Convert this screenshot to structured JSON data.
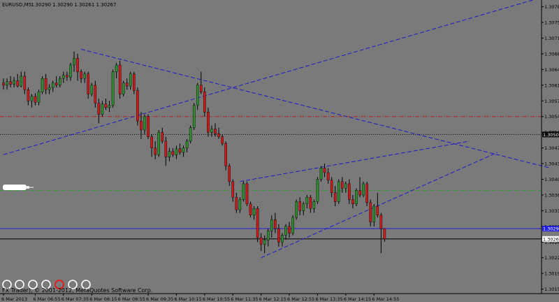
{
  "header": {
    "symbol_label": "EURUSD,M5",
    "ohlc_label": "1.30290 1.30290 1.30261 1.30267"
  },
  "footer": {
    "copyright_label": "FX Trader), © 2001-2012, MetaQuotes Software Corp."
  },
  "colors": {
    "background": "#7a7a7a",
    "bull_candle": "#2e8b2e",
    "bear_candle": "#cc1a1a",
    "wick": "#000000",
    "trendline": "#1c1cc8",
    "level_red": "#b22222",
    "level_black": "#000000",
    "level_green": "#2f9a2f",
    "level_blue": "#1f1fe0",
    "level_black_bottom": "#000000"
  },
  "chart_data": {
    "type": "candlestick",
    "timeframe": "M5",
    "y_axis_ticks": [
      1.30785,
      1.3075,
      1.30715,
      1.3068,
      1.30645,
      1.3061,
      1.30575,
      1.3054,
      1.30505,
      1.3047,
      1.30435,
      1.304,
      1.30365,
      1.3033,
      1.30295,
      1.3026,
      1.30225,
      1.3019,
      1.30155
    ],
    "ylim": [
      1.30145,
      1.308
    ],
    "x_tick_labels": [
      "6 Mar 2013",
      "6 Mar 06:55",
      "6 Mar 07:35",
      "6 Mar 08:15",
      "6 Mar 08:55",
      "6 Mar 09:35",
      "6 Mar 10:15",
      "6 Mar 10:55",
      "6 Mar 11:35",
      "6 Mar 12:15",
      "6 Mar 12:55",
      "6 Mar 13:35",
      "6 Mar 14:15",
      "6 Mar 14:55"
    ],
    "x_tick_bar_index": [
      0,
      9,
      17,
      25,
      33,
      41,
      49,
      57,
      65,
      73,
      81,
      89,
      97,
      105
    ],
    "horizontal_levels": [
      {
        "price": 1.3054,
        "style": "dash-dot",
        "color": "#b22222",
        "label": ""
      },
      {
        "price": 1.305,
        "style": "dotted",
        "color": "#000000",
        "label": "1.30500"
      },
      {
        "price": 1.30375,
        "style": "dash-dot",
        "color": "#2f9a2f",
        "label": ""
      },
      {
        "price": 1.3029,
        "style": "solid",
        "color": "#1f1fe0",
        "label": "1.30290"
      },
      {
        "price": 1.30267,
        "style": "solid",
        "color": "#000000",
        "label": "1.30267"
      }
    ],
    "trendlines": [
      {
        "from": [
          0,
          1.30455
        ],
        "to": [
          150,
          1.308
        ]
      },
      {
        "from": [
          22,
          1.3069
        ],
        "to": [
          155,
          1.30425
        ]
      },
      {
        "from": [
          67,
          1.30395
        ],
        "to": [
          132,
          1.30485
        ]
      },
      {
        "from": [
          73,
          1.30225
        ],
        "to": [
          140,
          1.3046
        ]
      }
    ],
    "candles": [
      {
        "o": 1.30615,
        "h": 1.30625,
        "l": 1.306,
        "c": 1.3061
      },
      {
        "o": 1.3061,
        "h": 1.30625,
        "l": 1.306,
        "c": 1.30618
      },
      {
        "o": 1.30618,
        "h": 1.3063,
        "l": 1.30605,
        "c": 1.30612
      },
      {
        "o": 1.30612,
        "h": 1.30628,
        "l": 1.30605,
        "c": 1.3062
      },
      {
        "o": 1.3062,
        "h": 1.30635,
        "l": 1.30605,
        "c": 1.30608
      },
      {
        "o": 1.30608,
        "h": 1.3064,
        "l": 1.30605,
        "c": 1.3063
      },
      {
        "o": 1.3063,
        "h": 1.3064,
        "l": 1.3059,
        "c": 1.306
      },
      {
        "o": 1.306,
        "h": 1.30605,
        "l": 1.30565,
        "c": 1.30575
      },
      {
        "o": 1.30575,
        "h": 1.3059,
        "l": 1.3056,
        "c": 1.30585
      },
      {
        "o": 1.30585,
        "h": 1.30592,
        "l": 1.30565,
        "c": 1.30572
      },
      {
        "o": 1.30572,
        "h": 1.306,
        "l": 1.30565,
        "c": 1.30595
      },
      {
        "o": 1.30595,
        "h": 1.3063,
        "l": 1.3059,
        "c": 1.30625
      },
      {
        "o": 1.30625,
        "h": 1.30635,
        "l": 1.3059,
        "c": 1.306
      },
      {
        "o": 1.306,
        "h": 1.30612,
        "l": 1.3059,
        "c": 1.30605
      },
      {
        "o": 1.30605,
        "h": 1.3062,
        "l": 1.30595,
        "c": 1.30615
      },
      {
        "o": 1.30615,
        "h": 1.3063,
        "l": 1.30605,
        "c": 1.3061
      },
      {
        "o": 1.3061,
        "h": 1.3063,
        "l": 1.30605,
        "c": 1.30625
      },
      {
        "o": 1.30625,
        "h": 1.3064,
        "l": 1.30615,
        "c": 1.30632
      },
      {
        "o": 1.30632,
        "h": 1.3064,
        "l": 1.3062,
        "c": 1.30628
      },
      {
        "o": 1.30628,
        "h": 1.3066,
        "l": 1.3062,
        "c": 1.30655
      },
      {
        "o": 1.30655,
        "h": 1.30685,
        "l": 1.3064,
        "c": 1.3067
      },
      {
        "o": 1.3067,
        "h": 1.3068,
        "l": 1.3062,
        "c": 1.3064
      },
      {
        "o": 1.3064,
        "h": 1.30645,
        "l": 1.30615,
        "c": 1.30625
      },
      {
        "o": 1.30625,
        "h": 1.3064,
        "l": 1.30615,
        "c": 1.30635
      },
      {
        "o": 1.30635,
        "h": 1.3064,
        "l": 1.3058,
        "c": 1.3059
      },
      {
        "o": 1.3059,
        "h": 1.30615,
        "l": 1.30585,
        "c": 1.3061
      },
      {
        "o": 1.3061,
        "h": 1.3062,
        "l": 1.3056,
        "c": 1.3057
      },
      {
        "o": 1.3057,
        "h": 1.3058,
        "l": 1.30525,
        "c": 1.30545
      },
      {
        "o": 1.30545,
        "h": 1.30575,
        "l": 1.3054,
        "c": 1.30568
      },
      {
        "o": 1.30568,
        "h": 1.3058,
        "l": 1.30555,
        "c": 1.3056
      },
      {
        "o": 1.3056,
        "h": 1.30575,
        "l": 1.3055,
        "c": 1.30565
      },
      {
        "o": 1.30565,
        "h": 1.30645,
        "l": 1.3056,
        "c": 1.3064
      },
      {
        "o": 1.3064,
        "h": 1.3066,
        "l": 1.30625,
        "c": 1.30655
      },
      {
        "o": 1.30655,
        "h": 1.30665,
        "l": 1.3058,
        "c": 1.3059
      },
      {
        "o": 1.3059,
        "h": 1.3062,
        "l": 1.30585,
        "c": 1.30615
      },
      {
        "o": 1.30615,
        "h": 1.30625,
        "l": 1.306,
        "c": 1.30608
      },
      {
        "o": 1.30608,
        "h": 1.3064,
        "l": 1.306,
        "c": 1.30635
      },
      {
        "o": 1.30635,
        "h": 1.3064,
        "l": 1.3059,
        "c": 1.30598
      },
      {
        "o": 1.30598,
        "h": 1.30605,
        "l": 1.3052,
        "c": 1.3053
      },
      {
        "o": 1.3053,
        "h": 1.3055,
        "l": 1.3049,
        "c": 1.3051
      },
      {
        "o": 1.3051,
        "h": 1.30545,
        "l": 1.305,
        "c": 1.3054
      },
      {
        "o": 1.3054,
        "h": 1.30545,
        "l": 1.3049,
        "c": 1.30495
      },
      {
        "o": 1.30495,
        "h": 1.305,
        "l": 1.3045,
        "c": 1.3047
      },
      {
        "o": 1.3047,
        "h": 1.30485,
        "l": 1.30445,
        "c": 1.30455
      },
      {
        "o": 1.30455,
        "h": 1.3051,
        "l": 1.3045,
        "c": 1.30505
      },
      {
        "o": 1.30505,
        "h": 1.30515,
        "l": 1.3048,
        "c": 1.30485
      },
      {
        "o": 1.30485,
        "h": 1.30495,
        "l": 1.3043,
        "c": 1.3045
      },
      {
        "o": 1.3045,
        "h": 1.3047,
        "l": 1.3044,
        "c": 1.30462
      },
      {
        "o": 1.30462,
        "h": 1.3047,
        "l": 1.3045,
        "c": 1.30455
      },
      {
        "o": 1.30455,
        "h": 1.30475,
        "l": 1.30445,
        "c": 1.30468
      },
      {
        "o": 1.30468,
        "h": 1.3048,
        "l": 1.30455,
        "c": 1.3046
      },
      {
        "o": 1.3046,
        "h": 1.30475,
        "l": 1.3045,
        "c": 1.3047
      },
      {
        "o": 1.3047,
        "h": 1.3049,
        "l": 1.3046,
        "c": 1.30485
      },
      {
        "o": 1.30485,
        "h": 1.3052,
        "l": 1.3048,
        "c": 1.30515
      },
      {
        "o": 1.30515,
        "h": 1.3057,
        "l": 1.3051,
        "c": 1.30565
      },
      {
        "o": 1.30565,
        "h": 1.30615,
        "l": 1.30555,
        "c": 1.3061
      },
      {
        "o": 1.3061,
        "h": 1.3064,
        "l": 1.3059,
        "c": 1.30595
      },
      {
        "o": 1.30595,
        "h": 1.30605,
        "l": 1.3054,
        "c": 1.3055
      },
      {
        "o": 1.3055,
        "h": 1.3056,
        "l": 1.30495,
        "c": 1.30505
      },
      {
        "o": 1.30505,
        "h": 1.3052,
        "l": 1.30495,
        "c": 1.30512
      },
      {
        "o": 1.30512,
        "h": 1.30525,
        "l": 1.30495,
        "c": 1.30502
      },
      {
        "o": 1.30502,
        "h": 1.30515,
        "l": 1.3049,
        "c": 1.30495
      },
      {
        "o": 1.30495,
        "h": 1.305,
        "l": 1.30475,
        "c": 1.3048
      },
      {
        "o": 1.3048,
        "h": 1.30485,
        "l": 1.3042,
        "c": 1.3043
      },
      {
        "o": 1.3043,
        "h": 1.30435,
        "l": 1.30385,
        "c": 1.30395
      },
      {
        "o": 1.30395,
        "h": 1.304,
        "l": 1.3035,
        "c": 1.3036
      },
      {
        "o": 1.3036,
        "h": 1.3037,
        "l": 1.30325,
        "c": 1.30332
      },
      {
        "o": 1.30332,
        "h": 1.3036,
        "l": 1.30325,
        "c": 1.30355
      },
      {
        "o": 1.30355,
        "h": 1.30395,
        "l": 1.3035,
        "c": 1.3039
      },
      {
        "o": 1.3039,
        "h": 1.30395,
        "l": 1.3034,
        "c": 1.30345
      },
      {
        "o": 1.30345,
        "h": 1.3035,
        "l": 1.30315,
        "c": 1.3032
      },
      {
        "o": 1.3032,
        "h": 1.3034,
        "l": 1.3031,
        "c": 1.30335
      },
      {
        "o": 1.30335,
        "h": 1.3034,
        "l": 1.3026,
        "c": 1.3027
      },
      {
        "o": 1.3027,
        "h": 1.3028,
        "l": 1.3024,
        "c": 1.30255
      },
      {
        "o": 1.30255,
        "h": 1.30275,
        "l": 1.30235,
        "c": 1.30265
      },
      {
        "o": 1.30265,
        "h": 1.3029,
        "l": 1.3025,
        "c": 1.30285
      },
      {
        "o": 1.30285,
        "h": 1.3032,
        "l": 1.3027,
        "c": 1.3031
      },
      {
        "o": 1.3031,
        "h": 1.30325,
        "l": 1.3028,
        "c": 1.3029
      },
      {
        "o": 1.3029,
        "h": 1.303,
        "l": 1.3025,
        "c": 1.3026
      },
      {
        "o": 1.3026,
        "h": 1.3028,
        "l": 1.3025,
        "c": 1.30275
      },
      {
        "o": 1.30275,
        "h": 1.303,
        "l": 1.30265,
        "c": 1.30295
      },
      {
        "o": 1.30295,
        "h": 1.30305,
        "l": 1.3027,
        "c": 1.3028
      },
      {
        "o": 1.3028,
        "h": 1.3032,
        "l": 1.30275,
        "c": 1.30315
      },
      {
        "o": 1.30315,
        "h": 1.30355,
        "l": 1.3031,
        "c": 1.3035
      },
      {
        "o": 1.3035,
        "h": 1.3036,
        "l": 1.3032,
        "c": 1.3033
      },
      {
        "o": 1.3033,
        "h": 1.3035,
        "l": 1.3032,
        "c": 1.30345
      },
      {
        "o": 1.30345,
        "h": 1.30365,
        "l": 1.30335,
        "c": 1.3036
      },
      {
        "o": 1.3036,
        "h": 1.30365,
        "l": 1.30325,
        "c": 1.30335
      },
      {
        "o": 1.30335,
        "h": 1.30355,
        "l": 1.30325,
        "c": 1.3035
      },
      {
        "o": 1.3035,
        "h": 1.30405,
        "l": 1.30345,
        "c": 1.304
      },
      {
        "o": 1.304,
        "h": 1.3043,
        "l": 1.30395,
        "c": 1.30425
      },
      {
        "o": 1.30425,
        "h": 1.30435,
        "l": 1.30405,
        "c": 1.30415
      },
      {
        "o": 1.30415,
        "h": 1.30425,
        "l": 1.3039,
        "c": 1.30398
      },
      {
        "o": 1.30398,
        "h": 1.30405,
        "l": 1.3036,
        "c": 1.3037
      },
      {
        "o": 1.3037,
        "h": 1.30385,
        "l": 1.3034,
        "c": 1.3035
      },
      {
        "o": 1.3035,
        "h": 1.304,
        "l": 1.30345,
        "c": 1.30395
      },
      {
        "o": 1.30395,
        "h": 1.30405,
        "l": 1.3037,
        "c": 1.3038
      },
      {
        "o": 1.3038,
        "h": 1.30395,
        "l": 1.3037,
        "c": 1.3039
      },
      {
        "o": 1.3039,
        "h": 1.304,
        "l": 1.30345,
        "c": 1.30355
      },
      {
        "o": 1.30355,
        "h": 1.30365,
        "l": 1.30335,
        "c": 1.30345
      },
      {
        "o": 1.30345,
        "h": 1.3038,
        "l": 1.3034,
        "c": 1.30375
      },
      {
        "o": 1.30375,
        "h": 1.30405,
        "l": 1.3036,
        "c": 1.30365
      },
      {
        "o": 1.30365,
        "h": 1.30395,
        "l": 1.3036,
        "c": 1.3039
      },
      {
        "o": 1.3039,
        "h": 1.30395,
        "l": 1.3034,
        "c": 1.30348
      },
      {
        "o": 1.30348,
        "h": 1.30355,
        "l": 1.30295,
        "c": 1.30305
      },
      {
        "o": 1.30305,
        "h": 1.30345,
        "l": 1.30295,
        "c": 1.3034
      },
      {
        "o": 1.3034,
        "h": 1.3037,
        "l": 1.30315,
        "c": 1.3032
      },
      {
        "o": 1.3032,
        "h": 1.30325,
        "l": 1.30235,
        "c": 1.3029
      },
      {
        "o": 1.3029,
        "h": 1.3029,
        "l": 1.30261,
        "c": 1.30267
      }
    ]
  }
}
